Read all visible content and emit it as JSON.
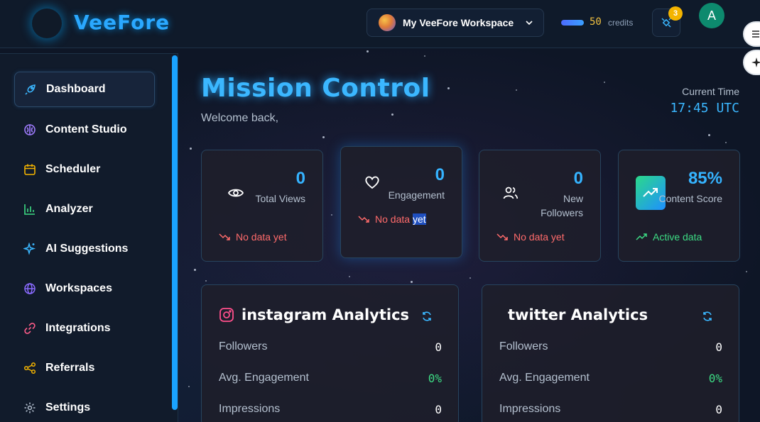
{
  "brand": {
    "name": "VeeFore"
  },
  "header": {
    "workspace_name": "My VeeFore Workspace",
    "credits_value": "50",
    "credits_label": "credits",
    "notification_count": "3",
    "user_initial": "A"
  },
  "sidebar": {
    "items": [
      {
        "label": "Dashboard",
        "icon": "rocket-icon",
        "active": true
      },
      {
        "label": "Content Studio",
        "icon": "brain-icon"
      },
      {
        "label": "Scheduler",
        "icon": "calendar-icon"
      },
      {
        "label": "Analyzer",
        "icon": "bar-chart-icon"
      },
      {
        "label": "AI Suggestions",
        "icon": "sparkles-icon"
      },
      {
        "label": "Workspaces",
        "icon": "globe-icon"
      },
      {
        "label": "Integrations",
        "icon": "link-icon"
      },
      {
        "label": "Referrals",
        "icon": "share-icon"
      },
      {
        "label": "Settings",
        "icon": "gear-icon"
      }
    ]
  },
  "main": {
    "title": "Mission Control",
    "welcome": "Welcome back,",
    "current_time_label": "Current Time",
    "current_time_value": "17:45 UTC"
  },
  "stats": [
    {
      "value": "0",
      "label": "Total Views",
      "trend": "No data yet",
      "icon": "eye-icon"
    },
    {
      "value": "0",
      "label": "Engagement",
      "trend_pre": "No data",
      "trend_hl": "yet",
      "icon": "heart-icon"
    },
    {
      "value": "0",
      "label": "New Followers",
      "trend": "No data yet",
      "icon": "users-icon"
    },
    {
      "value": "85%",
      "label": "Content Score",
      "trend": "Active data",
      "icon": "trending-up-icon"
    }
  ],
  "analytics": [
    {
      "title": "instagram Analytics",
      "rows": [
        {
          "label": "Followers",
          "value": "0"
        },
        {
          "label": "Avg. Engagement",
          "value": "0%"
        },
        {
          "label": "Impressions",
          "value": "0"
        }
      ]
    },
    {
      "title": "twitter Analytics",
      "rows": [
        {
          "label": "Followers",
          "value": "0"
        },
        {
          "label": "Avg. Engagement",
          "value": "0%"
        },
        {
          "label": "Impressions",
          "value": "0"
        }
      ]
    }
  ],
  "colors": {
    "accent": "#3bb7ff",
    "positive": "#3ddc84",
    "negative": "#ff6b6b",
    "badge": "#f4b400"
  }
}
